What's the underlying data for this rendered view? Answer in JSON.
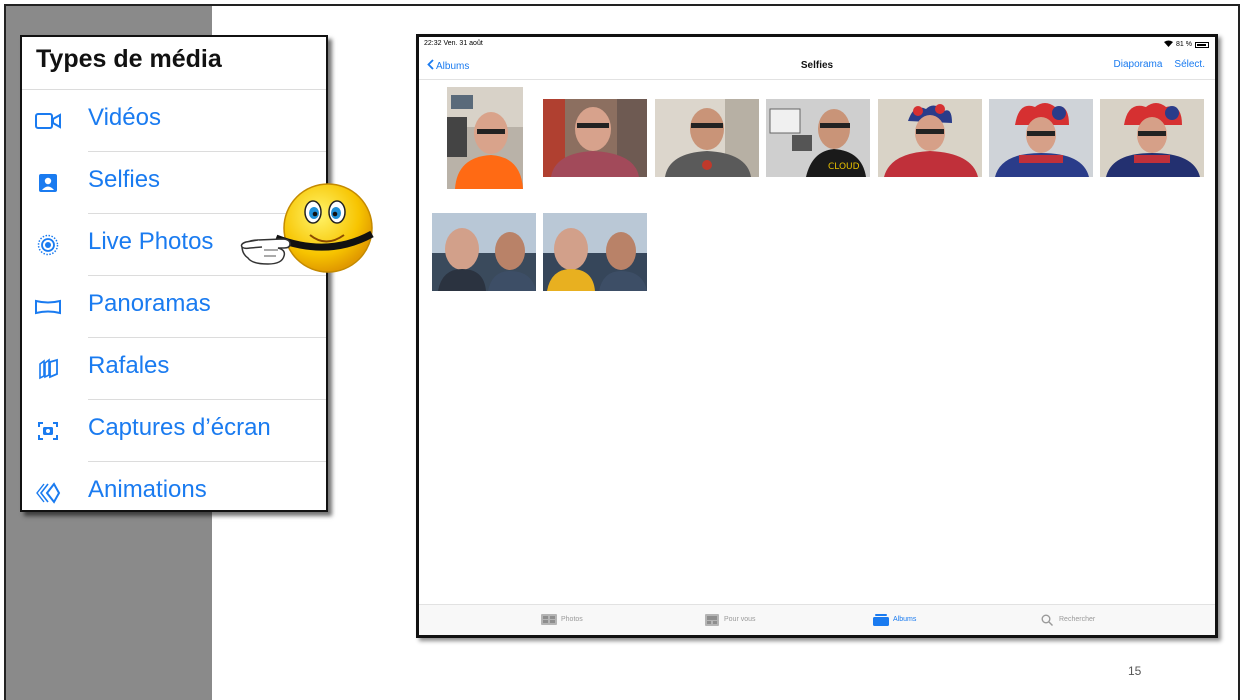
{
  "media_panel": {
    "title": "Types de média",
    "items": [
      {
        "label": "Vidéos",
        "icon": "video-icon"
      },
      {
        "label": "Selfies",
        "icon": "selfie-icon"
      },
      {
        "label": "Live Photos",
        "icon": "live-photo-icon"
      },
      {
        "label": "Panoramas",
        "icon": "panorama-icon"
      },
      {
        "label": "Rafales",
        "icon": "burst-icon"
      },
      {
        "label": "Captures d’écran",
        "icon": "screenshot-icon"
      },
      {
        "label": "Animations",
        "icon": "animation-icon"
      }
    ]
  },
  "ipad": {
    "status": {
      "time": "22:32 Ven. 31 août",
      "battery": "81 %"
    },
    "nav": {
      "back": "Albums",
      "title": "Selfies",
      "slideshow": "Diaporama",
      "select": "Sélect."
    },
    "tabs": [
      {
        "label": "Photos",
        "icon": "photos-tab-icon",
        "active": false
      },
      {
        "label": "Pour vous",
        "icon": "for-you-tab-icon",
        "active": false
      },
      {
        "label": "Albums",
        "icon": "albums-tab-icon",
        "active": true
      },
      {
        "label": "Rechercher",
        "icon": "search-tab-icon",
        "active": false
      }
    ]
  },
  "page_number": "15",
  "colors": {
    "accent": "#1a7bf0",
    "band": "#8a8a8a"
  }
}
